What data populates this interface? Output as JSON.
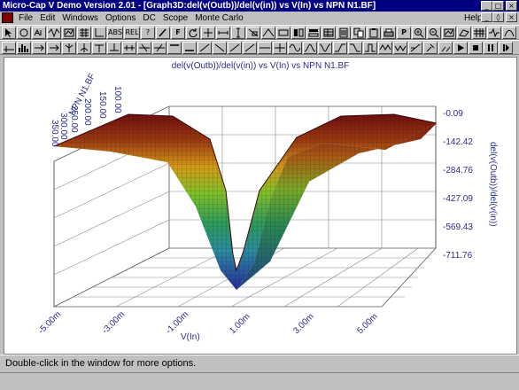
{
  "window": {
    "title": "Micro-Cap V Demo Version 2.01 - [Graph3D:del(v(Outb))/del(v(in)) vs V(In) vs NPN N1.BF]",
    "minimize_glyph": "_",
    "maximize_glyph": "□",
    "close_glyph": "×"
  },
  "menu": {
    "items": [
      "File",
      "Edit",
      "Windows",
      "Options",
      "DC",
      "Scope",
      "Monte Carlo"
    ],
    "help": "Help",
    "restore_glyph": "◊"
  },
  "toolbar1": {
    "labels": {
      "abs": "ABS",
      "rel": "REL",
      "help": "?",
      "font": "F",
      "p": "P"
    }
  },
  "graph": {
    "title": "del(v(Outb))/del(v(in)) vs V(In) vs NPN N1.BF",
    "x_axis_label": "V(In)",
    "z_axis_label": "del(v(Outb))/del(v(in))",
    "y_axis_label": "NPN N1.BF",
    "x_ticks": [
      "-5.00m",
      "-3.00m",
      "-1.00m",
      "1.00m",
      "3.00m",
      "5.00m"
    ],
    "z_ticks": [
      "-0.09",
      "-142.42",
      "-284.76",
      "-427.09",
      "-569.43",
      "-711.76"
    ],
    "y_ticks": [
      "100.00",
      "150.00",
      "200.00",
      "250.00",
      "300.00",
      "350.00"
    ]
  },
  "status": {
    "text": "Double-click in the window for more options."
  },
  "colors": {
    "titlebar": "#000080",
    "axis_text": "#2b2b8a",
    "surface_high": "#7a1010",
    "surface_low": "#2a2a9a"
  }
}
